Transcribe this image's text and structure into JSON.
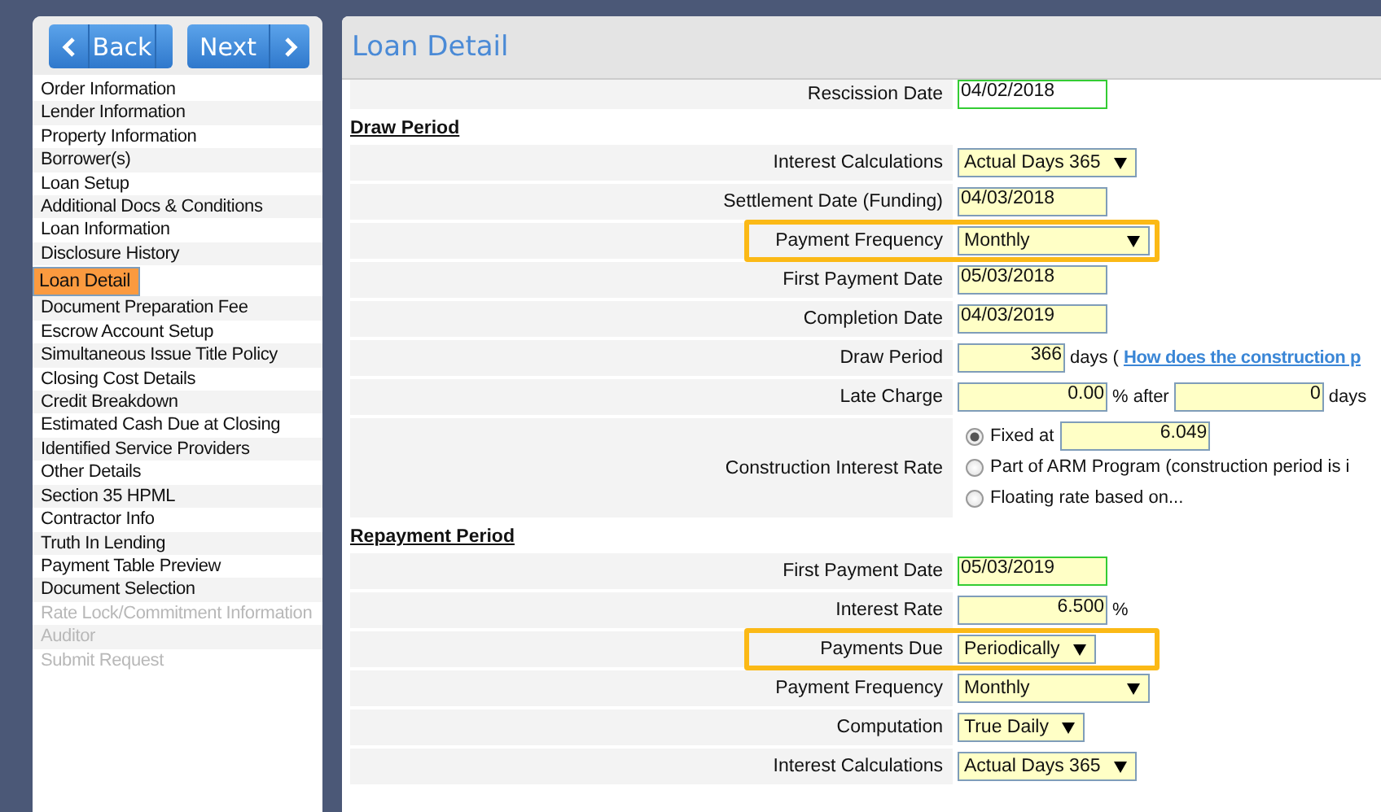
{
  "nav_buttons": [
    {
      "label": "Back"
    },
    {
      "label": "Next"
    }
  ],
  "sidebar": {
    "items": [
      {
        "label": "Order Information",
        "selected": false,
        "disabled": false
      },
      {
        "label": "Lender Information",
        "selected": false,
        "disabled": false
      },
      {
        "label": "Property Information",
        "selected": false,
        "disabled": false
      },
      {
        "label": "Borrower(s)",
        "selected": false,
        "disabled": false
      },
      {
        "label": "Loan Setup",
        "selected": false,
        "disabled": false
      },
      {
        "label": "Additional Docs & Conditions",
        "selected": false,
        "disabled": false
      },
      {
        "label": "Loan Information",
        "selected": false,
        "disabled": false
      },
      {
        "label": "Disclosure History",
        "selected": false,
        "disabled": false
      },
      {
        "label": "Loan Detail",
        "selected": true,
        "disabled": false
      },
      {
        "label": "Document Preparation Fee",
        "selected": false,
        "disabled": false
      },
      {
        "label": "Escrow Account Setup",
        "selected": false,
        "disabled": false
      },
      {
        "label": "Simultaneous Issue Title Policy",
        "selected": false,
        "disabled": false
      },
      {
        "label": "Closing Cost Details",
        "selected": false,
        "disabled": false
      },
      {
        "label": "Credit Breakdown",
        "selected": false,
        "disabled": false
      },
      {
        "label": "Estimated Cash Due at Closing",
        "selected": false,
        "disabled": false
      },
      {
        "label": "Identified Service Providers",
        "selected": false,
        "disabled": false
      },
      {
        "label": "Other Details",
        "selected": false,
        "disabled": false
      },
      {
        "label": "Section 35 HPML",
        "selected": false,
        "disabled": false
      },
      {
        "label": "Contractor Info",
        "selected": false,
        "disabled": false
      },
      {
        "label": "Truth In Lending",
        "selected": false,
        "disabled": false
      },
      {
        "label": "Payment Table Preview",
        "selected": false,
        "disabled": false
      },
      {
        "label": "Document Selection",
        "selected": false,
        "disabled": false
      },
      {
        "label": "Rate Lock/Commitment Information",
        "selected": false,
        "disabled": true
      },
      {
        "label": "Auditor",
        "selected": false,
        "disabled": true
      },
      {
        "label": "Submit Request",
        "selected": false,
        "disabled": true
      }
    ]
  },
  "panel": {
    "title": "Loan Detail"
  },
  "sections": [
    {
      "rows": [
        {
          "label": "Rescission Date",
          "highlighted": false,
          "controls": [
            {
              "kind": "date",
              "value": "04/02/2018",
              "valid": true,
              "readonly": true
            }
          ]
        }
      ]
    },
    {
      "heading": "Draw Period",
      "rows": [
        {
          "label": "Interest Calculations",
          "highlighted": false,
          "controls": [
            {
              "kind": "select",
              "value": "Actual Days 365"
            }
          ]
        },
        {
          "label": "Settlement Date (Funding)",
          "highlighted": false,
          "controls": [
            {
              "kind": "date",
              "value": "04/03/2018",
              "valid": false
            }
          ]
        },
        {
          "label": "Payment Frequency",
          "highlighted": true,
          "controls": [
            {
              "kind": "select",
              "value": "Monthly",
              "wide": true
            }
          ]
        },
        {
          "label": "First Payment Date",
          "highlighted": false,
          "controls": [
            {
              "kind": "date",
              "value": "05/03/2018",
              "valid": false
            }
          ]
        },
        {
          "label": "Completion Date",
          "highlighted": false,
          "controls": [
            {
              "kind": "date",
              "value": "04/03/2019",
              "valid": false
            }
          ]
        },
        {
          "label": "Draw Period",
          "highlighted": false,
          "controls": [
            {
              "kind": "number",
              "value": "366",
              "valid": false,
              "short": true
            },
            {
              "kind": "text",
              "value": "days ("
            },
            {
              "kind": "link",
              "value": "How does the construction p"
            }
          ]
        },
        {
          "label": "Late Charge",
          "highlighted": false,
          "controls": [
            {
              "kind": "number",
              "value": "0.00",
              "valid": false
            },
            {
              "kind": "text",
              "value": "% after"
            },
            {
              "kind": "number",
              "value": "0",
              "valid": false
            },
            {
              "kind": "text",
              "value": "days"
            }
          ]
        },
        {
          "label": "Construction Interest Rate",
          "highlighted": false,
          "controls": [
            {
              "kind": "radio",
              "label": "Fixed at",
              "selected": true,
              "input": {
                "value": "6.049",
                "valid": false
              }
            },
            {
              "kind": "radio",
              "label": "Part of ARM Program (construction period is i",
              "selected": false
            },
            {
              "kind": "radio",
              "label": "Floating rate based on...",
              "selected": false
            }
          ]
        }
      ]
    },
    {
      "heading": "Repayment Period",
      "rows": [
        {
          "label": "First Payment Date",
          "highlighted": false,
          "controls": [
            {
              "kind": "date",
              "value": "05/03/2019",
              "valid": true
            }
          ]
        },
        {
          "label": "Interest Rate",
          "highlighted": false,
          "controls": [
            {
              "kind": "number",
              "value": "6.500",
              "valid": false
            },
            {
              "kind": "text",
              "value": "%"
            }
          ]
        },
        {
          "label": "Payments Due",
          "highlighted": true,
          "controls": [
            {
              "kind": "select",
              "value": "Periodically"
            }
          ]
        },
        {
          "label": "Payment Frequency",
          "highlighted": false,
          "controls": [
            {
              "kind": "select",
              "value": "Monthly",
              "wide": true
            }
          ]
        },
        {
          "label": "Computation",
          "highlighted": false,
          "controls": [
            {
              "kind": "select",
              "value": "True Daily"
            }
          ]
        },
        {
          "label": "Interest Calculations",
          "highlighted": false,
          "controls": [
            {
              "kind": "select",
              "value": "Actual Days 365"
            }
          ]
        }
      ]
    }
  ]
}
